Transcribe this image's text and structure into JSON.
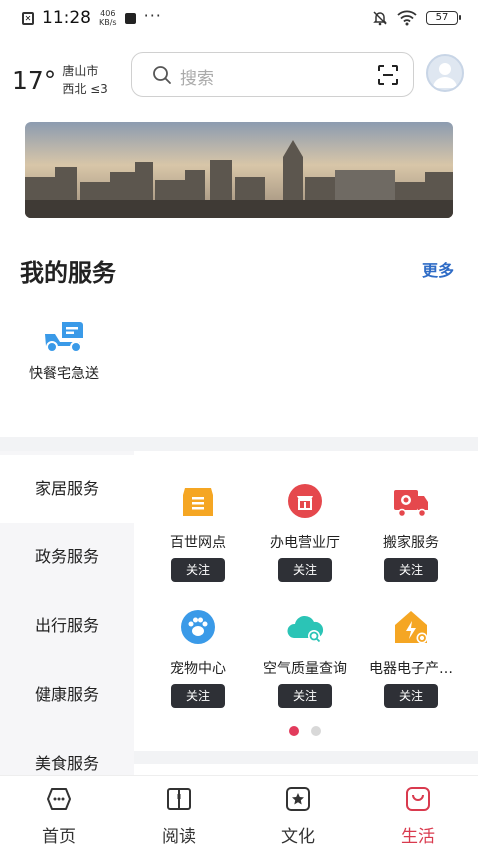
{
  "status_bar": {
    "time": "11:28",
    "net_speed_value": "406",
    "net_speed_unit": "KB/s",
    "more_dots": "···",
    "battery": "57"
  },
  "header": {
    "temperature": "17°",
    "city": "唐山市",
    "wind": "西北 ≤3",
    "search_placeholder": "搜索"
  },
  "my_services": {
    "title": "我的服务",
    "more_label": "更多",
    "items": [
      {
        "label": "快餐宅急送",
        "icon": "delivery-scooter-icon"
      }
    ]
  },
  "categories": [
    {
      "label": "家居服务",
      "active": true
    },
    {
      "label": "政务服务",
      "active": false
    },
    {
      "label": "出行服务",
      "active": false
    },
    {
      "label": "健康服务",
      "active": false
    },
    {
      "label": "美食服务",
      "active": false
    }
  ],
  "service_tiles": [
    {
      "name": "百世网点",
      "icon": "box-icon",
      "follow": "关注"
    },
    {
      "name": "办电营业厅",
      "icon": "shop-icon",
      "follow": "关注"
    },
    {
      "name": "搬家服务",
      "icon": "truck-icon",
      "follow": "关注"
    },
    {
      "name": "宠物中心",
      "icon": "paw-icon",
      "follow": "关注"
    },
    {
      "name": "空气质量查询",
      "icon": "cloud-search-icon",
      "follow": "关注"
    },
    {
      "name": "电器电子产…",
      "icon": "bolt-house-icon",
      "follow": "关注"
    }
  ],
  "pager": {
    "pages": 2,
    "current": 1
  },
  "bottom_nav": [
    {
      "label": "首页",
      "icon": "home-icon",
      "active": false
    },
    {
      "label": "阅读",
      "icon": "book-icon",
      "active": false
    },
    {
      "label": "文化",
      "icon": "culture-star-icon",
      "active": false
    },
    {
      "label": "生活",
      "icon": "life-bag-icon",
      "active": true
    }
  ],
  "colors": {
    "accent_blue": "#2f6cc6",
    "active_red": "#d93a4e",
    "follow_button": "#2e3036",
    "delivery_icon": "#3a9ae8",
    "box_icon": "#f5a623",
    "shop_icon": "#e5484d",
    "truck_icon": "#e5484d",
    "paw_icon": "#3a9ae8",
    "cloud_icon": "#2bc4b6",
    "bolt_icon": "#f5a623"
  }
}
